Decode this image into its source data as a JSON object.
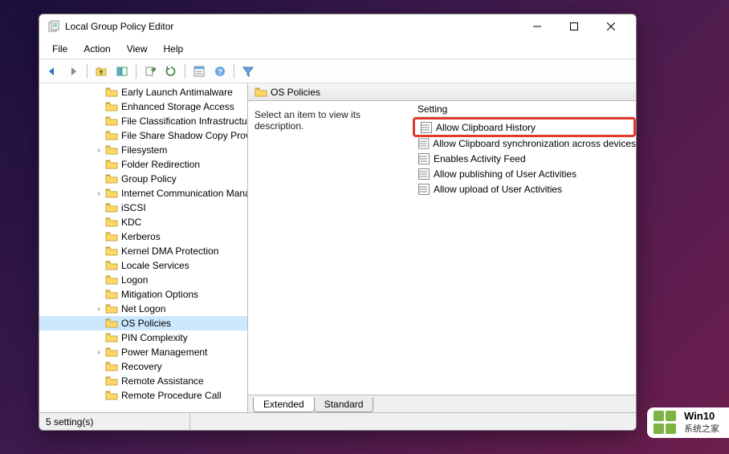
{
  "window": {
    "title": "Local Group Policy Editor"
  },
  "menu": {
    "items": [
      "File",
      "Action",
      "View",
      "Help"
    ]
  },
  "toolbar": {
    "icons": [
      "back",
      "forward",
      "sep",
      "up-folder",
      "show-hide",
      "sep",
      "export",
      "refresh",
      "sep",
      "properties",
      "help",
      "sep",
      "filter"
    ]
  },
  "tree": {
    "items": [
      {
        "label": "Early Launch Antimalware",
        "indent": 4,
        "exp": ""
      },
      {
        "label": "Enhanced Storage Access",
        "indent": 4,
        "exp": ""
      },
      {
        "label": "File Classification Infrastructure",
        "indent": 4,
        "exp": ""
      },
      {
        "label": "File Share Shadow Copy Provider",
        "indent": 4,
        "exp": ""
      },
      {
        "label": "Filesystem",
        "indent": 4,
        "exp": ">"
      },
      {
        "label": "Folder Redirection",
        "indent": 4,
        "exp": ""
      },
      {
        "label": "Group Policy",
        "indent": 4,
        "exp": ""
      },
      {
        "label": "Internet Communication Management",
        "indent": 4,
        "exp": ">"
      },
      {
        "label": "iSCSI",
        "indent": 4,
        "exp": ""
      },
      {
        "label": "KDC",
        "indent": 4,
        "exp": ""
      },
      {
        "label": "Kerberos",
        "indent": 4,
        "exp": ""
      },
      {
        "label": "Kernel DMA Protection",
        "indent": 4,
        "exp": ""
      },
      {
        "label": "Locale Services",
        "indent": 4,
        "exp": ""
      },
      {
        "label": "Logon",
        "indent": 4,
        "exp": ""
      },
      {
        "label": "Mitigation Options",
        "indent": 4,
        "exp": ""
      },
      {
        "label": "Net Logon",
        "indent": 4,
        "exp": ">"
      },
      {
        "label": "OS Policies",
        "indent": 4,
        "exp": "",
        "selected": true
      },
      {
        "label": "PIN Complexity",
        "indent": 4,
        "exp": ""
      },
      {
        "label": "Power Management",
        "indent": 4,
        "exp": ">"
      },
      {
        "label": "Recovery",
        "indent": 4,
        "exp": ""
      },
      {
        "label": "Remote Assistance",
        "indent": 4,
        "exp": ""
      },
      {
        "label": "Remote Procedure Call",
        "indent": 4,
        "exp": ""
      }
    ]
  },
  "right": {
    "header": "OS Policies",
    "description": "Select an item to view its description.",
    "column_header": "Setting",
    "settings": [
      {
        "label": "Allow Clipboard History",
        "highlighted": true
      },
      {
        "label": "Allow Clipboard synchronization across devices",
        "highlighted": false
      },
      {
        "label": "Enables Activity Feed",
        "highlighted": false
      },
      {
        "label": "Allow publishing of User Activities",
        "highlighted": false
      },
      {
        "label": "Allow upload of User Activities",
        "highlighted": false
      }
    ],
    "tabs": {
      "extended": "Extended",
      "standard": "Standard"
    }
  },
  "status": {
    "text": "5 setting(s)"
  },
  "watermark": {
    "title": "Win10",
    "subtitle": "系统之家"
  }
}
